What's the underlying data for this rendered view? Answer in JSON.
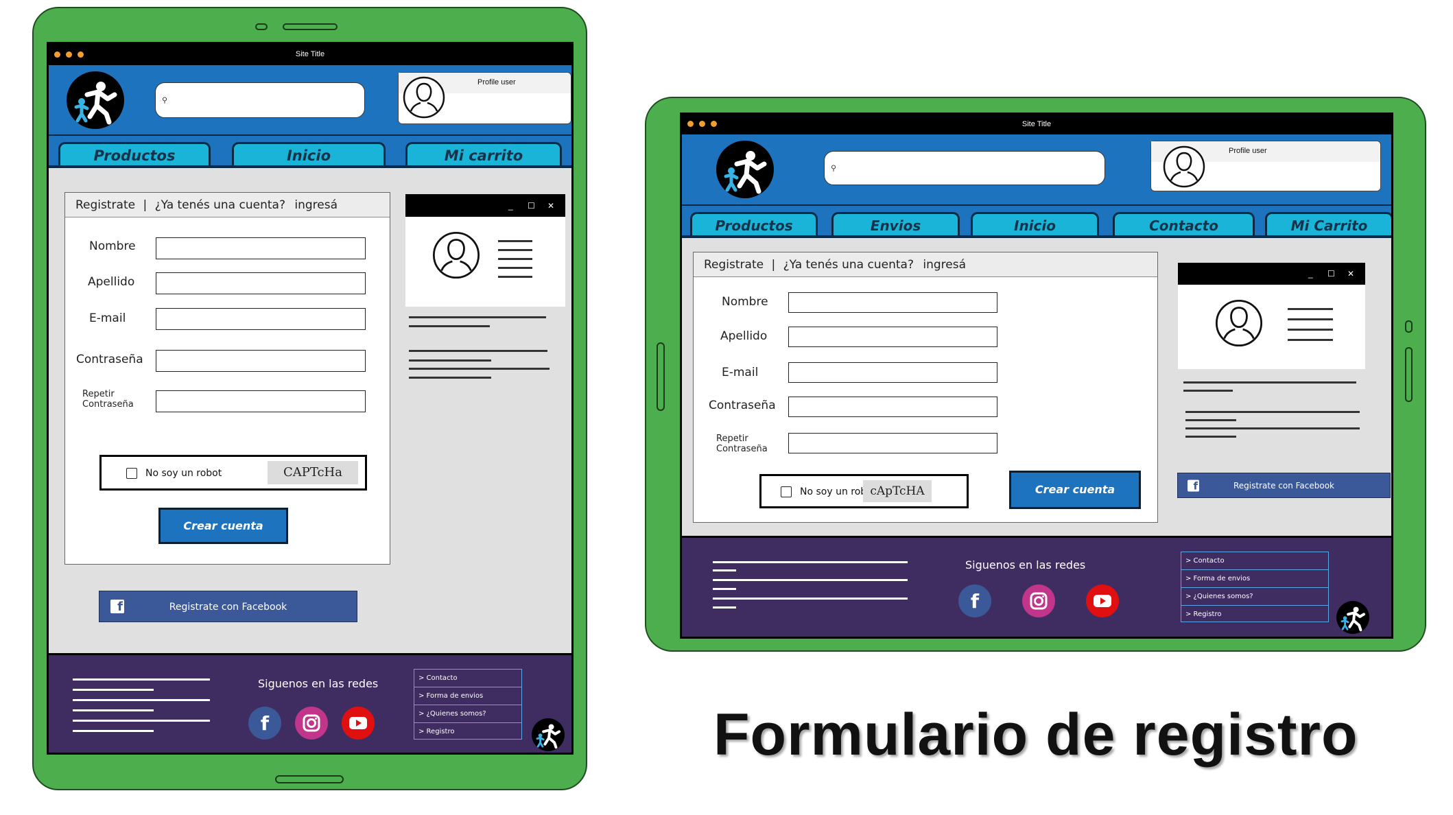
{
  "window_title": "Site Title",
  "profile_label": "Profile user",
  "portrait_nav": [
    "Productos",
    "Inicio",
    "Mi carrito"
  ],
  "landscape_nav": [
    "Productos",
    "Envios",
    "Inicio",
    "Contacto",
    "Mi Carrito"
  ],
  "form": {
    "tab_registrate": "Registrate",
    "separator": "|",
    "question": "¿Ya tenés una cuenta?",
    "login_link": "ingresá",
    "fields": [
      {
        "label": "Nombre"
      },
      {
        "label": "Apellido"
      },
      {
        "label": "E-mail"
      },
      {
        "label": "Contraseña"
      },
      {
        "label": "Repetir Contraseña"
      }
    ],
    "repeat_line1": "Repetir",
    "repeat_line2": "Contraseña",
    "captcha_text": "No soy un robot",
    "captcha_image": "CAPTcHa",
    "captcha_image_landscape": "cApTcHA",
    "create_button": "Crear cuenta",
    "facebook_button": "Registrate con Facebook"
  },
  "footer": {
    "social_title": "Siguenos en las redes",
    "social_icons": [
      "facebook-icon",
      "instagram-icon",
      "youtube-icon"
    ],
    "links": [
      "> Contacto",
      "> Forma de envios",
      "> ¿Quienes somos?",
      "> Registro"
    ]
  },
  "caption": "Formulario de registro",
  "colors": {
    "tablet_green": "#4cae4c",
    "header_blue": "#1e73be",
    "tab_cyan": "#1ab4d8",
    "footer_purple": "#3f2d62",
    "facebook_blue": "#3b5998"
  }
}
